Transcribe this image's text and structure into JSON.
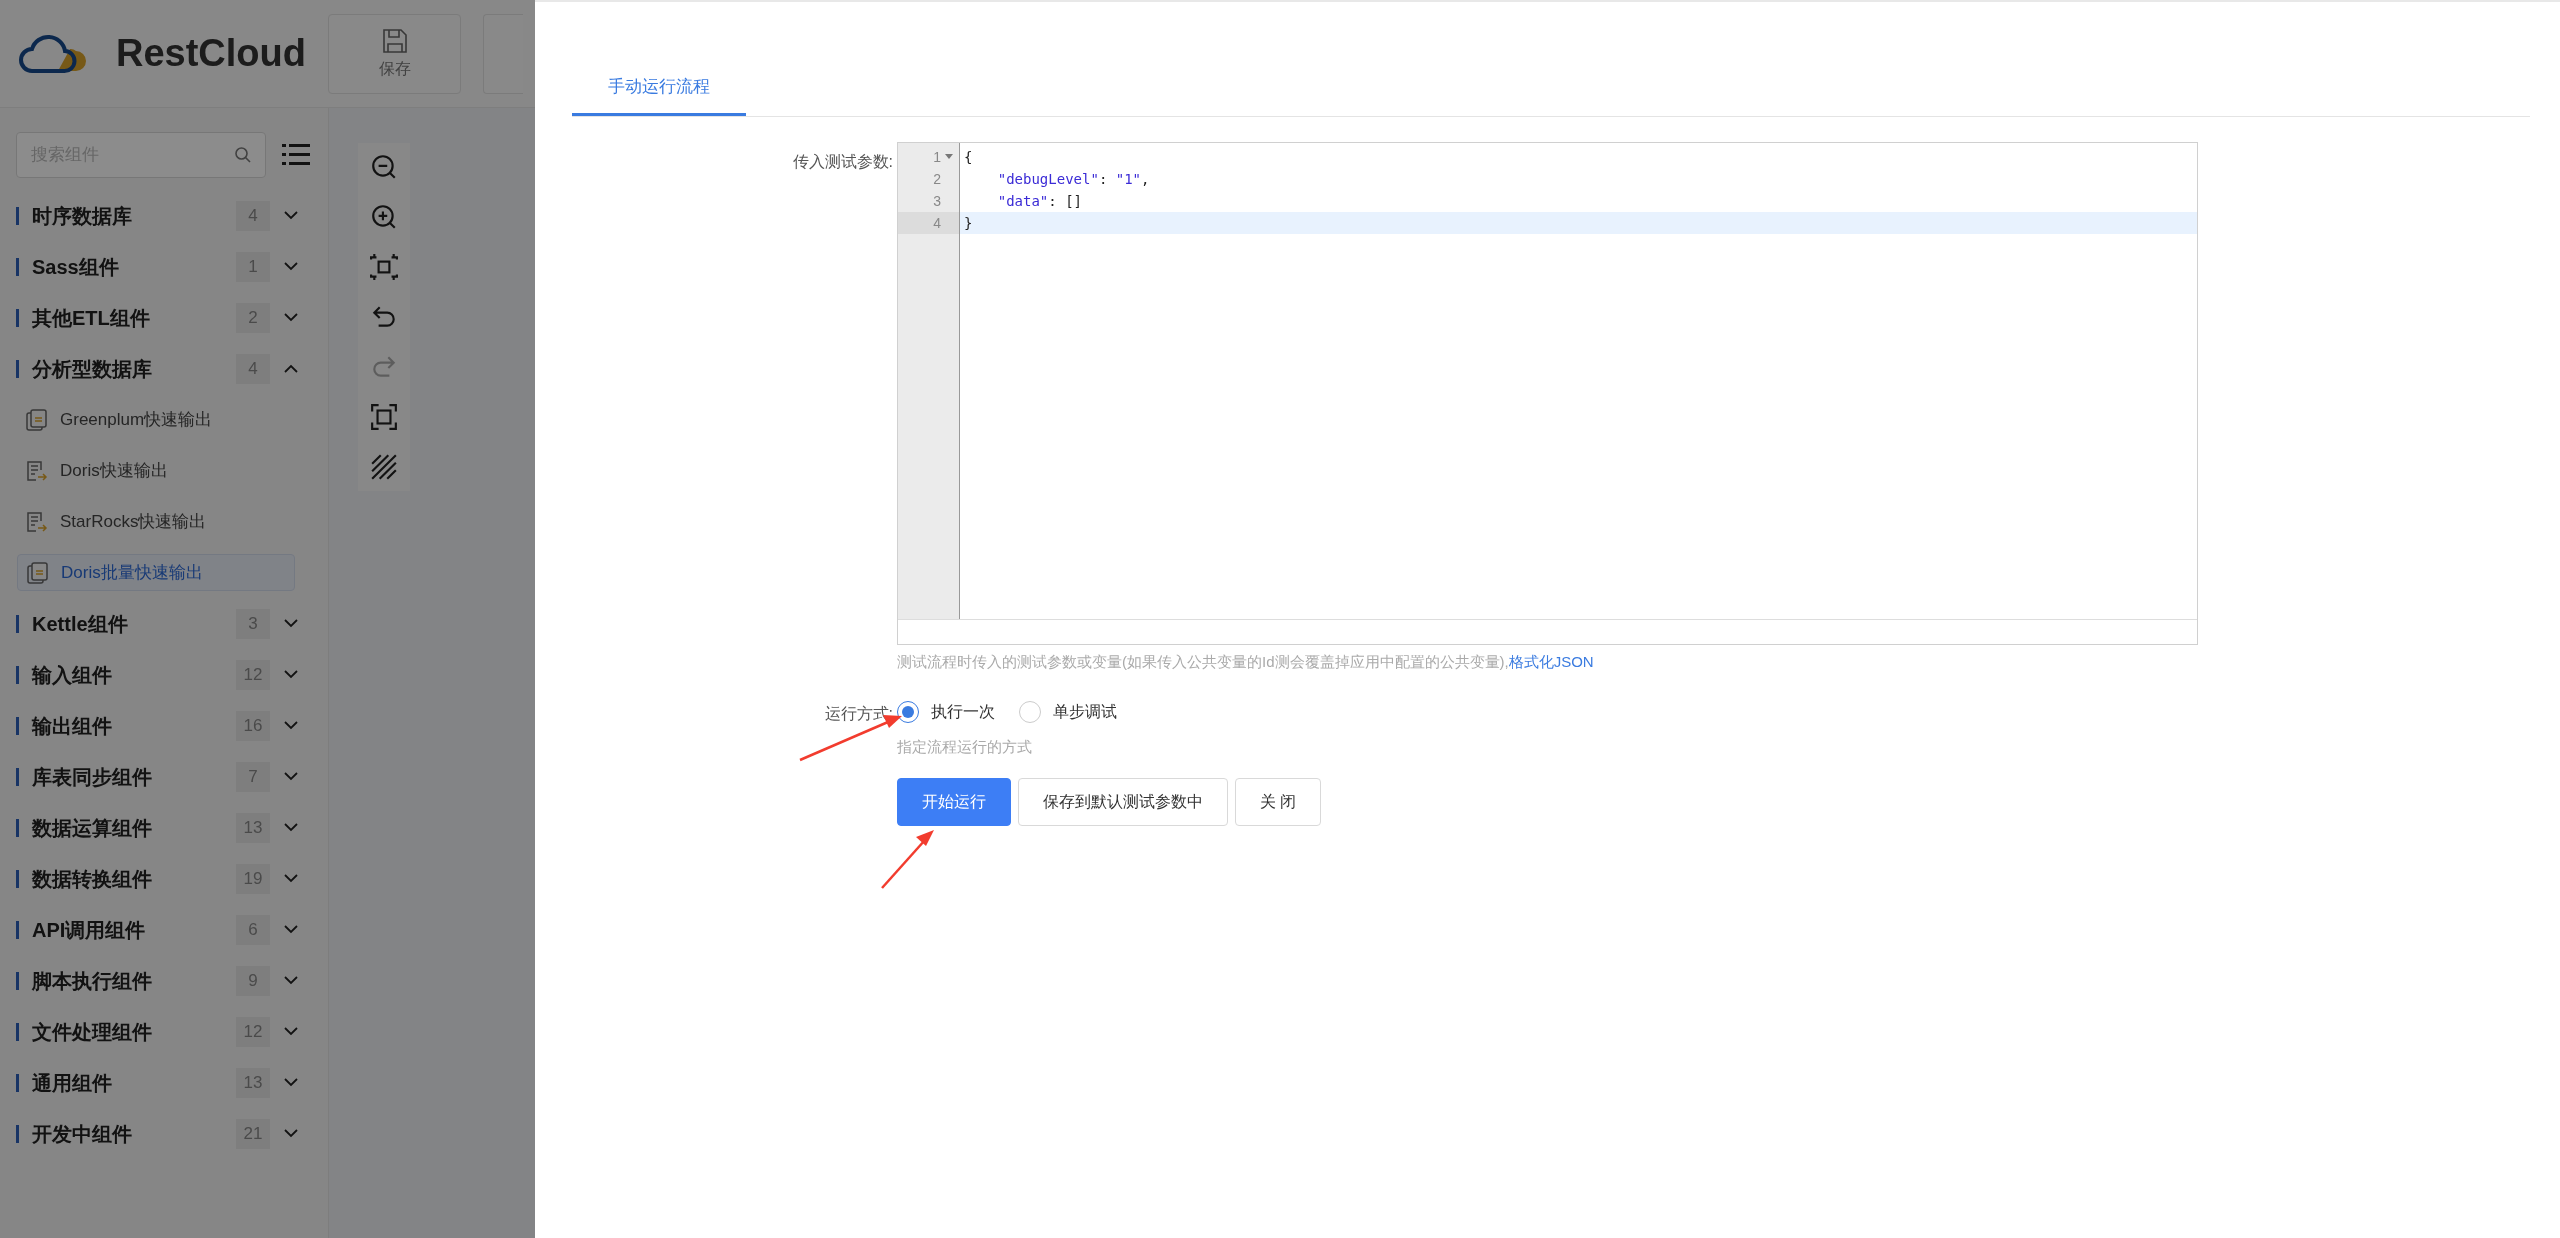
{
  "header": {
    "logo_text": "RestCloud",
    "toolbar": [
      {
        "kind": "save",
        "label": "保存"
      },
      {
        "kind": "partial"
      }
    ]
  },
  "sidebar": {
    "search": {
      "placeholder": "搜索组件"
    },
    "groups": [
      {
        "label": "时序数据库",
        "count": "4",
        "expanded": false
      },
      {
        "label": "Sass组件",
        "count": "1",
        "expanded": false
      },
      {
        "label": "其他ETL组件",
        "count": "2",
        "expanded": false
      },
      {
        "label": "分析型数据库",
        "count": "4",
        "expanded": true,
        "children": [
          {
            "label": "Greenplum快速输出",
            "kind": "copy",
            "selected": false
          },
          {
            "label": "Doris快速输出",
            "kind": "export",
            "selected": false
          },
          {
            "label": "StarRocks快速输出",
            "kind": "export",
            "selected": false
          },
          {
            "label": "Doris批量快速输出",
            "kind": "copy",
            "selected": true
          }
        ]
      },
      {
        "label": "Kettle组件",
        "count": "3",
        "expanded": false
      },
      {
        "label": "输入组件",
        "count": "12",
        "expanded": false
      },
      {
        "label": "输出组件",
        "count": "16",
        "expanded": false
      },
      {
        "label": "库表同步组件",
        "count": "7",
        "expanded": false
      },
      {
        "label": "数据运算组件",
        "count": "13",
        "expanded": false
      },
      {
        "label": "数据转换组件",
        "count": "19",
        "expanded": false
      },
      {
        "label": "API调用组件",
        "count": "6",
        "expanded": false
      },
      {
        "label": "脚本执行组件",
        "count": "9",
        "expanded": false
      },
      {
        "label": "文件处理组件",
        "count": "12",
        "expanded": false
      },
      {
        "label": "通用组件",
        "count": "13",
        "expanded": false
      },
      {
        "label": "开发中组件",
        "count": "21",
        "expanded": false
      }
    ]
  },
  "canvas_toolbar": [
    {
      "kind": "zoom-out",
      "disabled": false
    },
    {
      "kind": "zoom-in",
      "disabled": false
    },
    {
      "kind": "fit",
      "disabled": false
    },
    {
      "kind": "undo",
      "disabled": false
    },
    {
      "kind": "redo",
      "disabled": true
    },
    {
      "kind": "fullscreen",
      "disabled": false
    },
    {
      "kind": "grid",
      "disabled": false
    }
  ],
  "drawer": {
    "tabs": [
      {
        "label": "手动运行流程",
        "selected": true
      }
    ],
    "params": {
      "label": "传入测试参数:",
      "lines": [
        {
          "number": "1",
          "text": "{",
          "foldable": true,
          "active": false
        },
        {
          "number": "2",
          "text": "    \"debugLevel\": \"1\",",
          "foldable": false,
          "active": false
        },
        {
          "number": "3",
          "text": "    \"data\": []",
          "foldable": false,
          "active": false
        },
        {
          "number": "4",
          "text": "}",
          "foldable": false,
          "active": true
        }
      ],
      "help": "测试流程时传入的测试参数或变量(如果传入公共变量的Id测会覆盖掉应用中配置的公共变量),",
      "help_link": "格式化JSON"
    },
    "mode": {
      "label": "运行方式:",
      "options": [
        {
          "label": "执行一次",
          "selected": true
        },
        {
          "label": "单步调试",
          "selected": false
        }
      ],
      "hint": "指定流程运行的方式"
    },
    "buttons": [
      {
        "label": "开始运行",
        "kind": "primary"
      },
      {
        "label": "保存到默认测试参数中",
        "kind": "default"
      },
      {
        "label": "关 闭",
        "kind": "default"
      }
    ]
  }
}
